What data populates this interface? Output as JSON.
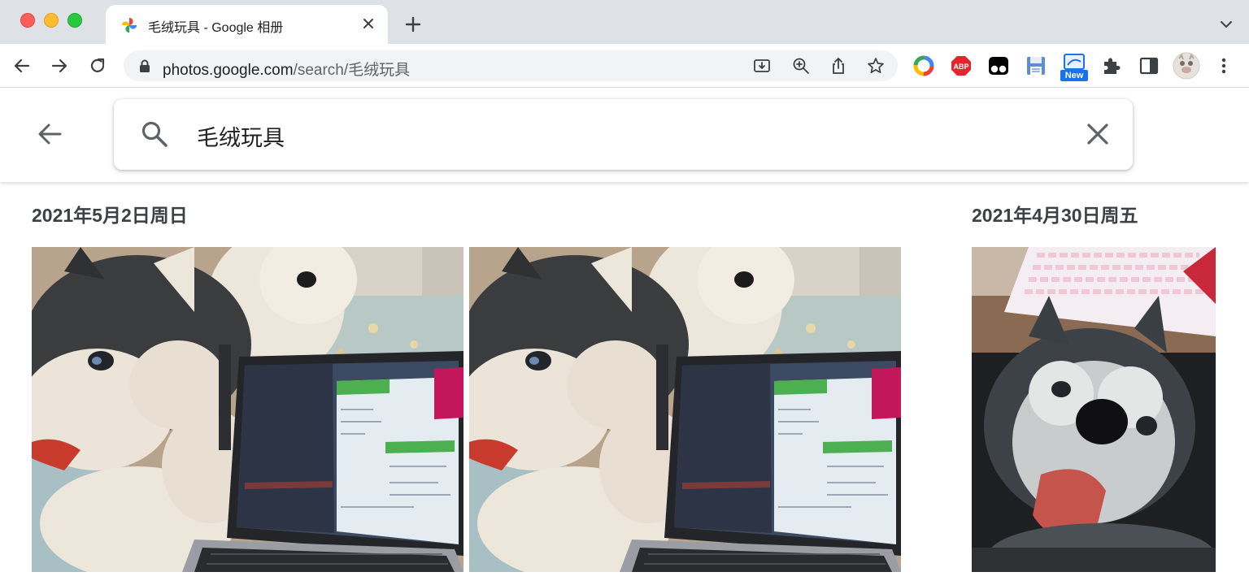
{
  "browser": {
    "tab": {
      "title": "毛绒玩具 - Google 相册",
      "favicon": "google-photos-pinwheel-icon"
    },
    "address": {
      "host": "photos.google.com",
      "path": "/search/毛绒玩具"
    },
    "extension_badge": "New"
  },
  "search": {
    "query": "毛绒玩具"
  },
  "groups": [
    {
      "date": "2021年5月2日周日"
    },
    {
      "date": "2021年4月30日周五"
    }
  ],
  "photos": [
    {
      "subject": "plush-husky-with-laptop"
    },
    {
      "subject": "plush-husky-with-laptop"
    },
    {
      "subject": "plush-husky-with-keyboard"
    }
  ],
  "colors": {
    "accent": "#1a73e8",
    "tabstrip": "#dee1e6",
    "omnibox": "#f1f3f4"
  }
}
